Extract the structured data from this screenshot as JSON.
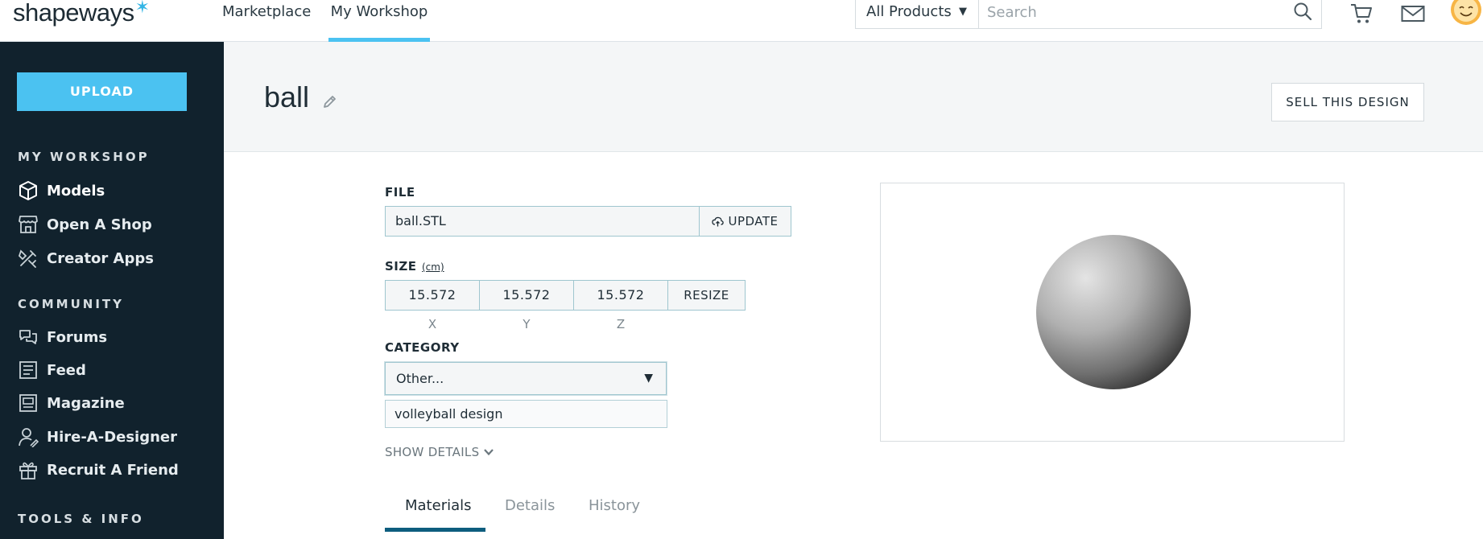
{
  "topbar": {
    "logo": "shapeways",
    "nav": {
      "marketplace": "Marketplace",
      "my_workshop": "My Workshop"
    },
    "products_select": "All Products",
    "search_placeholder": "Search"
  },
  "sidebar": {
    "upload_label": "UPLOAD",
    "sections": {
      "workshop": "MY WORKSHOP",
      "community": "COMMUNITY",
      "tools": "TOOLS & INFO"
    },
    "workshop_items": [
      "Models",
      "Open A Shop",
      "Creator Apps"
    ],
    "community_items": [
      "Forums",
      "Feed",
      "Magazine",
      "Hire-A-Designer",
      "Recruit A Friend"
    ]
  },
  "header": {
    "design_name": "ball",
    "sell_label": "SELL THIS DESIGN"
  },
  "form": {
    "file_label": "FILE",
    "file_name": "ball.STL",
    "update_label": "UPDATE",
    "size_label": "SIZE",
    "size_unit": "(cm)",
    "size": {
      "x": "15.572",
      "y": "15.572",
      "z": "15.572"
    },
    "axis": {
      "x": "X",
      "y": "Y",
      "z": "Z"
    },
    "resize_label": "RESIZE",
    "category_label": "CATEGORY",
    "category_value": "Other...",
    "subcategory_value": "volleyball design",
    "show_details": "SHOW DETAILS"
  },
  "tabs": [
    "Materials",
    "Details",
    "History"
  ],
  "colors": {
    "accent": "#4bc2f1",
    "sidebar_bg": "#11222d",
    "active_tab": "#0d5d7e"
  }
}
